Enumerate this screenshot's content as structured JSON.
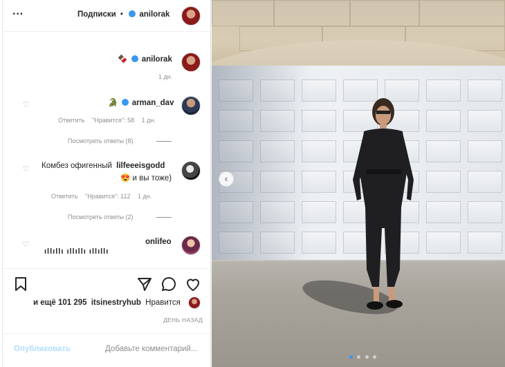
{
  "header": {
    "username": "anilorak",
    "follow_label": "Подписки",
    "separator": "•",
    "more_label": "···"
  },
  "caption": {
    "username": "anilorak",
    "emoji": "🍫",
    "time": "1 дн."
  },
  "comments": [
    {
      "username": "arman_dav",
      "emoji": "🐊",
      "time": "1 дн.",
      "likes": "\"Нравится\": 58",
      "reply_label": "Ответить",
      "view_replies": "Посмотреть ответы (8)"
    },
    {
      "username": "lilfeeeisgodd",
      "text_line1": "Комбез офигенный",
      "text_line2": "и вы тоже)",
      "emoji": "😍",
      "time": "1 дн.",
      "likes": "\"Нравится\": 112",
      "reply_label": "Ответить",
      "view_replies": "Посмотреть ответы (2)"
    },
    {
      "username": "onlifeo",
      "text": "ıllıllı ıllıllı ıllıllı"
    }
  ],
  "actions": {
    "liked_by_prefix": "Нравится",
    "liked_by_user": "itsinestryhub",
    "liked_by_suffix": "и ещё 101 295",
    "timestamp": "ДЕНЬ НАЗАД"
  },
  "footer": {
    "comment_placeholder": "Добавьте комментарий...",
    "publish_label": "Опубликовать"
  },
  "photo": {
    "prev_label": "‹",
    "pages": 4,
    "active_page": 1
  },
  "colors": {
    "accent": "#3897f0",
    "text": "#262626",
    "muted": "#8e8e8e"
  }
}
